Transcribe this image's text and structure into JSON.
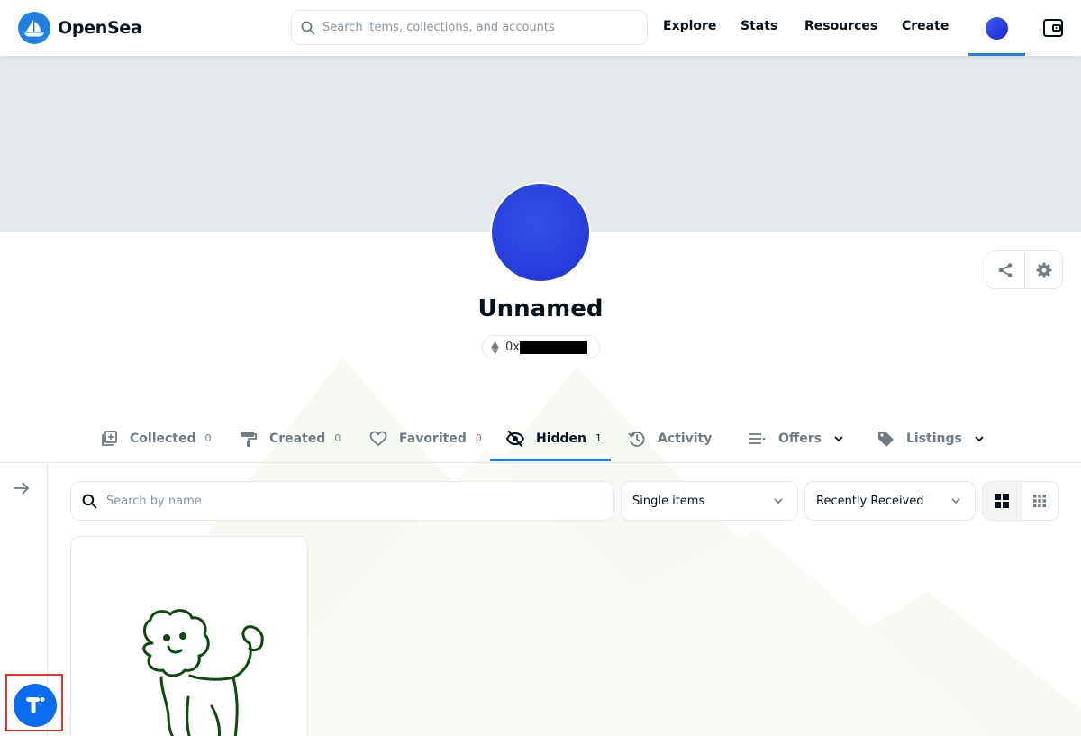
{
  "brand": {
    "name": "OpenSea"
  },
  "search": {
    "placeholder": "Search items, collections, and accounts"
  },
  "nav": {
    "links": [
      "Explore",
      "Stats",
      "Resources",
      "Create"
    ]
  },
  "profile": {
    "name": "Unnamed",
    "address_prefix": "0x"
  },
  "tabs": [
    {
      "label": "Collected",
      "count": "0"
    },
    {
      "label": "Created",
      "count": "0"
    },
    {
      "label": "Favorited",
      "count": "0"
    },
    {
      "label": "Hidden",
      "count": "1"
    },
    {
      "label": "Activity"
    },
    {
      "label": "Offers"
    },
    {
      "label": "Listings"
    }
  ],
  "filters": {
    "name_search_placeholder": "Search by name",
    "item_type": "Single items",
    "sort": "Recently Received"
  },
  "colors": {
    "accent": "#2081e2",
    "floating_button": "#0a6cf2",
    "highlight_box": "#e0362c"
  }
}
